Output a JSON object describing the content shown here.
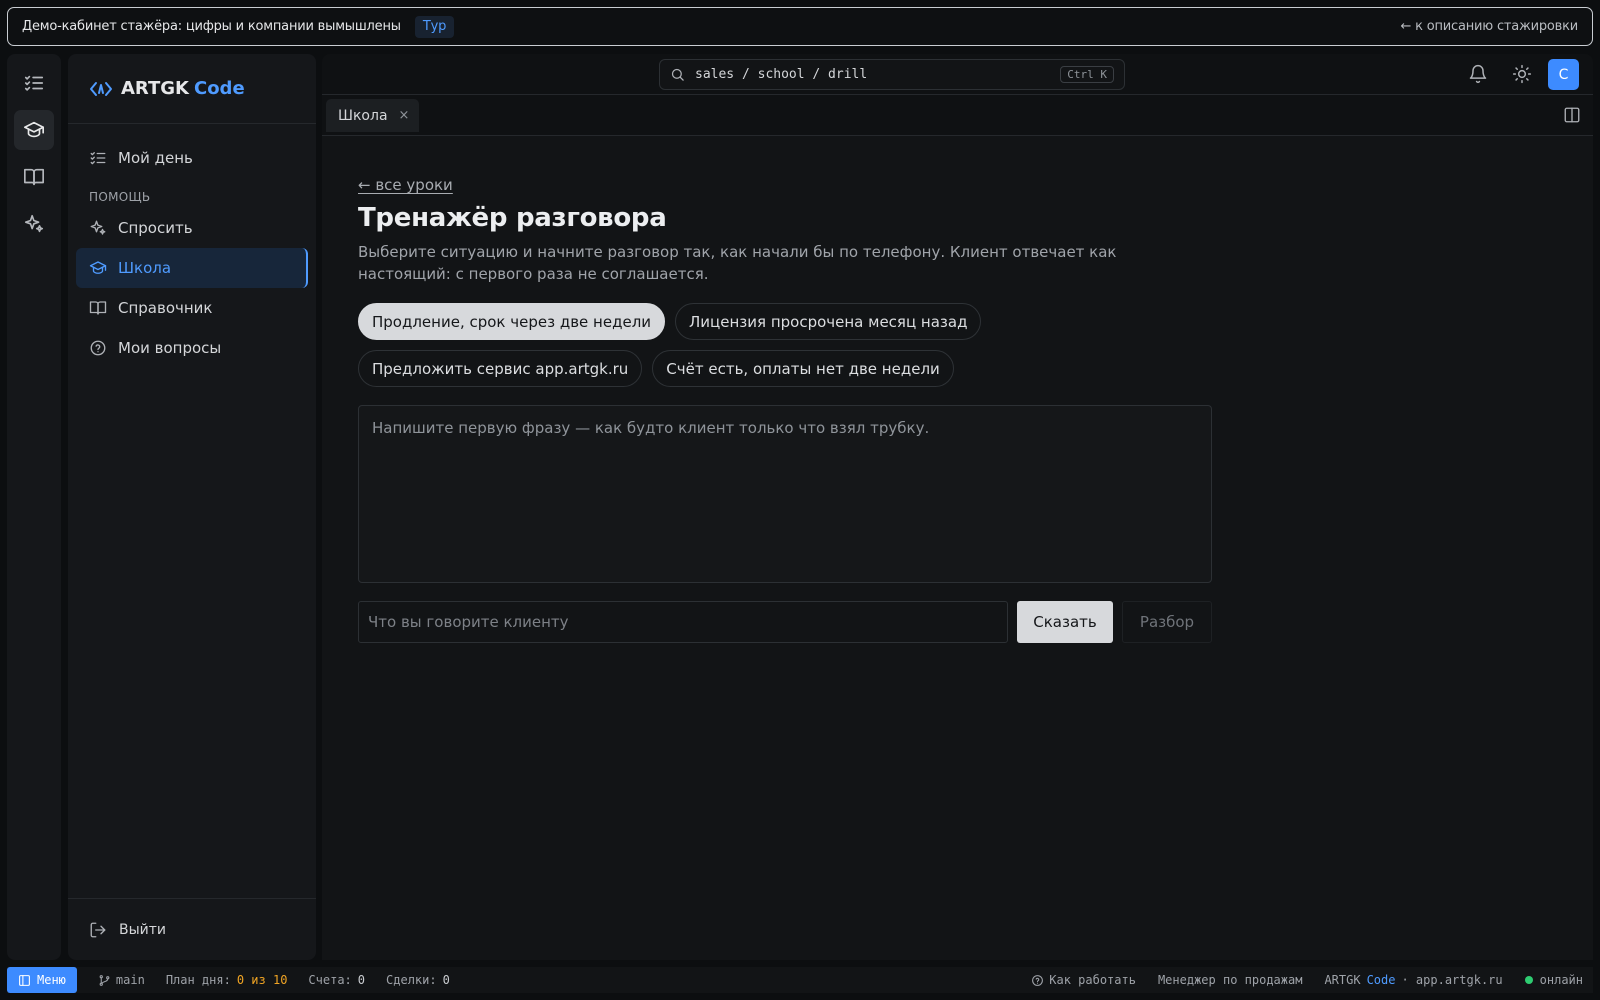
{
  "banner": {
    "text": "Демо-кабинет стажёра: цифры и компании вымышлены",
    "tour": "Тур",
    "back": "← к описанию стажировки"
  },
  "rail": {
    "items": [
      "my-day",
      "school",
      "reference",
      "ask"
    ]
  },
  "sidebar": {
    "logo_main": "ARTGK",
    "logo_accent": "Code",
    "my_day": "Мой день",
    "section_help": "ПОМОЩЬ",
    "items": [
      {
        "label": "Спросить"
      },
      {
        "label": "Школа"
      },
      {
        "label": "Справочник"
      },
      {
        "label": "Мои вопросы"
      }
    ],
    "logout": "Выйти"
  },
  "topbar": {
    "search_path": "sales / school / drill",
    "shortcut": "Ctrl K",
    "avatar_letter": "С"
  },
  "tab": {
    "label": "Школа",
    "close": "×"
  },
  "content": {
    "back_link": "← все уроки",
    "title": "Тренажёр разговора",
    "description": "Выберите ситуацию и начните разговор так, как начали бы по телефону. Клиент отвечает как настоящий: с первого раза не соглашается.",
    "scenarios": [
      "Продление, срок через две недели",
      "Лицензия просрочена месяц назад",
      "Предложить сервис app.artgk.ru",
      "Счёт есть, оплаты нет две недели"
    ],
    "selected_scenario": 0,
    "dialog_placeholder": "Напишите первую фразу — как будто клиент только что взял трубку.",
    "input_placeholder": "Что вы говорите клиенту",
    "say_button": "Сказать",
    "review_button": "Разбор"
  },
  "status": {
    "menu": "Меню",
    "branch": "main",
    "plan_label": "План дня:",
    "plan_value": "0 из 10",
    "invoices_label": "Счета:",
    "invoices_value": "0",
    "deals_label": "Сделки:",
    "deals_value": "0",
    "how_to": "Как работать",
    "role": "Менеджер по продажам",
    "brand_main": "ARTGK",
    "brand_accent": "Code",
    "brand_site": "· app.artgk.ru",
    "online": "онлайн"
  },
  "colors": {
    "accent": "#3d8bff",
    "background": "#121416",
    "highlight": "#f0a424",
    "online": "#2ecc71"
  }
}
